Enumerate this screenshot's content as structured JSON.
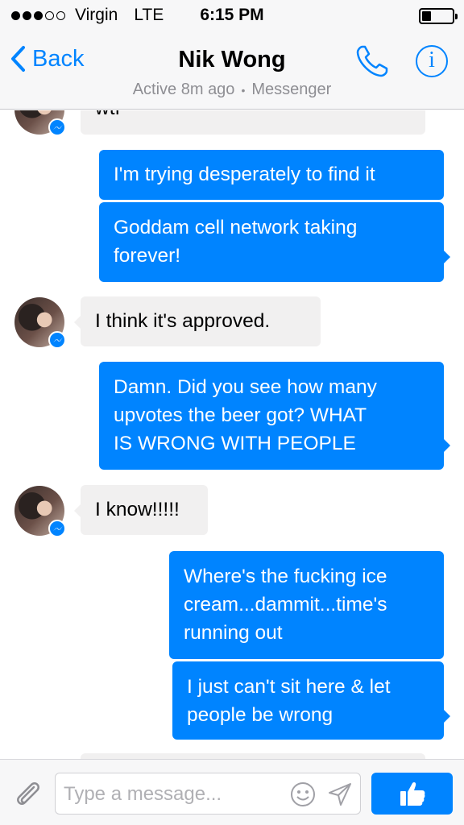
{
  "status_bar": {
    "carrier": "Virgin",
    "network": "LTE",
    "time": "6:15 PM",
    "signal_bars_filled": 3,
    "signal_bars_total": 5,
    "battery_level": 0.3
  },
  "nav": {
    "back_label": "Back",
    "title": "Nik Wong",
    "active_status": "Active 8m ago",
    "separator": "•",
    "source": "Messenger",
    "info_label": "i",
    "accent_color": "#0084ff"
  },
  "messages": [
    {
      "from": "them",
      "text": "wtf"
    },
    {
      "from": "me",
      "text": "I'm trying desperately to find it"
    },
    {
      "from": "me",
      "line1": "Goddam cell network taking",
      "line2": "forever!"
    },
    {
      "from": "them",
      "text": "I think it's approved."
    },
    {
      "from": "me",
      "line1": "Damn. Did you see how many",
      "line2": "upvotes the beer got? WHAT",
      "line3": "IS WRONG WITH PEOPLE"
    },
    {
      "from": "them",
      "text": "I know!!!!!"
    },
    {
      "from": "me",
      "line1": "Where's the fucking ice",
      "line2": "cream...dammit...time's",
      "line3": "running out"
    },
    {
      "from": "me",
      "line1": "I just can't sit here & let",
      "line2": "people be wrong"
    }
  ],
  "composer": {
    "placeholder": "Type a message...",
    "attach_icon": "paperclip-icon",
    "emoji_icon": "smiley-icon",
    "send_icon": "send-arrow-icon",
    "like_icon": "thumbs-up-icon"
  }
}
